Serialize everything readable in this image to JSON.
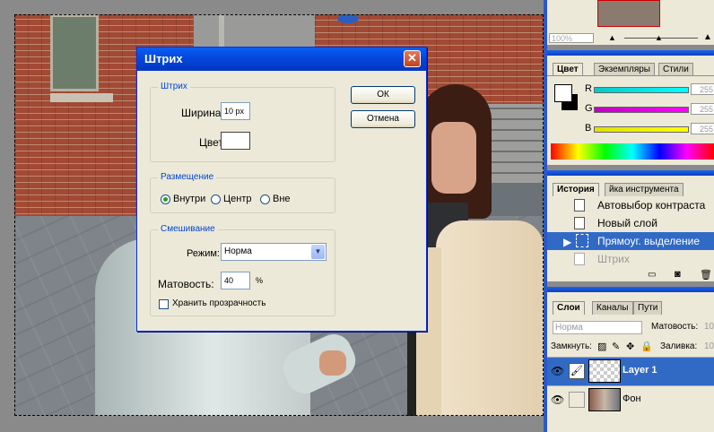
{
  "dialog": {
    "title": "Штрих",
    "ok": "ОК",
    "cancel": "Отмена",
    "stroke_group": "Штрих",
    "width_label": "Ширина:",
    "width_value": "10 px",
    "color_label": "Цвет:",
    "placement_group": "Размещение",
    "placement_options": [
      "Внутри",
      "Центр",
      "Вне"
    ],
    "placement_selected": "Внутри",
    "blend_group": "Смешивание",
    "mode_label": "Режим:",
    "mode_value": "Норма",
    "opacity_label": "Матовость:",
    "opacity_value": "40",
    "opacity_unit": "%",
    "preserve_label": "Хранить прозрачность"
  },
  "navigator": {
    "zoom": "100%"
  },
  "color_panel": {
    "tabs": [
      "Цвет",
      "Экземпляры",
      "Стили"
    ],
    "channels": [
      {
        "label": "R",
        "value": "255",
        "color": "#00e5e5"
      },
      {
        "label": "G",
        "value": "255",
        "color": "#e000e0"
      },
      {
        "label": "B",
        "value": "255",
        "color": "#ffff00"
      }
    ]
  },
  "history_panel": {
    "tabs": [
      "История",
      "йка инструмента"
    ],
    "items": [
      "Автовыбор контраста",
      "Новый слой",
      "Прямоуг. выделение",
      "Штрих"
    ],
    "active_index": 2
  },
  "layers_panel": {
    "tabs": [
      "Слои",
      "Каналы",
      "Пути"
    ],
    "blend_mode": "Норма",
    "opacity_label": "Матовость:",
    "opacity_value": "10",
    "lock_label": "Замкнуть:",
    "fill_label": "Заливка:",
    "fill_value": "10",
    "layers": [
      "Layer 1",
      "Фон"
    ]
  },
  "colors": {
    "accent": "#316ac5",
    "titlebar": "#0a5ef5",
    "panel_bg": "#ece9d8"
  }
}
